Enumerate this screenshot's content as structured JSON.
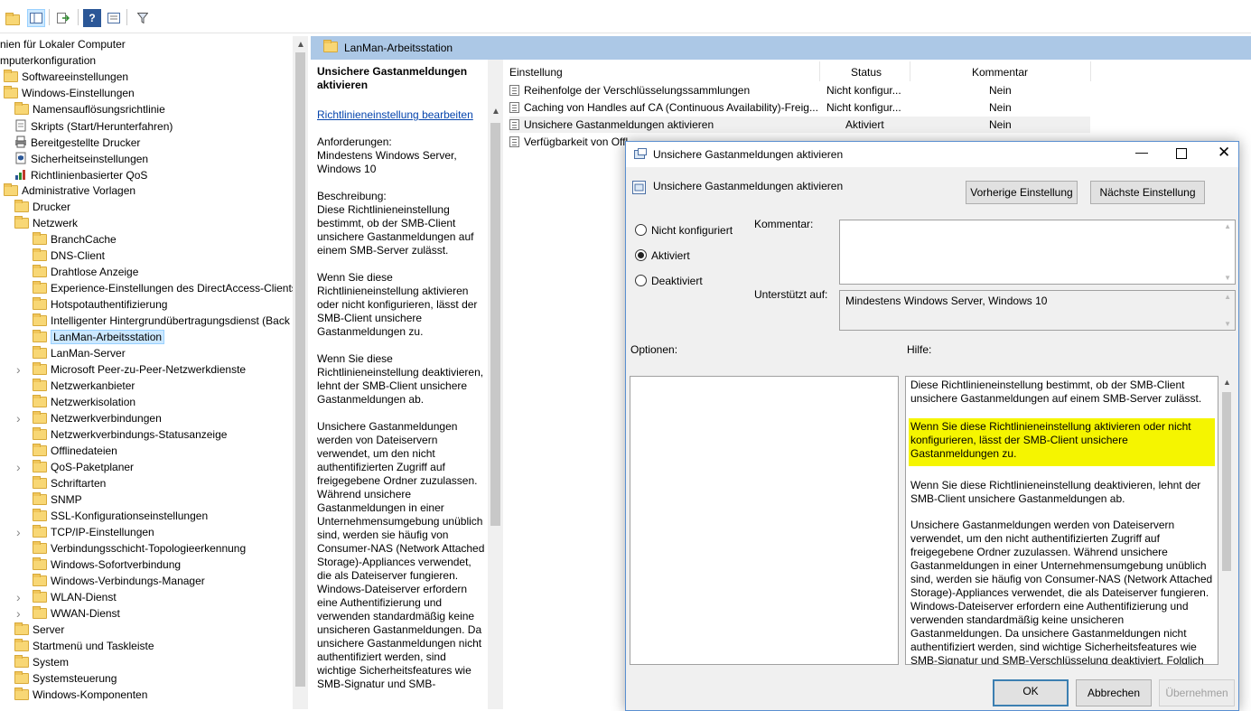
{
  "toolbar": {
    "icons": [
      "folder-icon",
      "show-hide-tree-icon",
      "export-icon",
      "help-icon",
      "properties-icon",
      "filter-icon"
    ]
  },
  "tree": {
    "items": [
      {
        "label": "nien für Lokaler Computer",
        "level": 0
      },
      {
        "label": "mputerkonfiguration",
        "level": 0
      },
      {
        "label": "Softwareeinstellungen",
        "level": 1
      },
      {
        "label": "Windows-Einstellungen",
        "level": 1
      },
      {
        "label": "Namensauflösungsrichtlinie",
        "level": 2
      },
      {
        "label": "Skripts (Start/Herunterfahren)",
        "level": 2
      },
      {
        "label": "Bereitgestellte Drucker",
        "level": 2
      },
      {
        "label": "Sicherheitseinstellungen",
        "level": 2
      },
      {
        "label": "Richtlinienbasierter QoS",
        "level": 2
      },
      {
        "label": "Administrative Vorlagen",
        "level": 1
      },
      {
        "label": "Drucker",
        "level": 2
      },
      {
        "label": "Netzwerk",
        "level": 2
      },
      {
        "label": "BranchCache",
        "level": 3
      },
      {
        "label": "DNS-Client",
        "level": 3
      },
      {
        "label": "Drahtlose Anzeige",
        "level": 3
      },
      {
        "label": "Experience-Einstellungen des DirectAccess-Clients",
        "level": 3
      },
      {
        "label": "Hotspotauthentifizierung",
        "level": 3
      },
      {
        "label": "Intelligenter Hintergrundübertragungsdienst (Back",
        "level": 3
      },
      {
        "label": "LanMan-Arbeitsstation",
        "level": 3
      },
      {
        "label": "LanMan-Server",
        "level": 3
      },
      {
        "label": "Microsoft Peer-zu-Peer-Netzwerkdienste",
        "level": 3
      },
      {
        "label": "Netzwerkanbieter",
        "level": 3
      },
      {
        "label": "Netzwerkisolation",
        "level": 3
      },
      {
        "label": "Netzwerkverbindungen",
        "level": 3
      },
      {
        "label": "Netzwerkverbindungs-Statusanzeige",
        "level": 3
      },
      {
        "label": "Offlinedateien",
        "level": 3
      },
      {
        "label": "QoS-Paketplaner",
        "level": 3
      },
      {
        "label": "Schriftarten",
        "level": 3
      },
      {
        "label": "SNMP",
        "level": 3
      },
      {
        "label": "SSL-Konfigurationseinstellungen",
        "level": 3
      },
      {
        "label": "TCP/IP-Einstellungen",
        "level": 3
      },
      {
        "label": "Verbindungsschicht-Topologieerkennung",
        "level": 3
      },
      {
        "label": "Windows-Sofortverbindung",
        "level": 3
      },
      {
        "label": "Windows-Verbindungs-Manager",
        "level": 3
      },
      {
        "label": "WLAN-Dienst",
        "level": 3
      },
      {
        "label": "WWAN-Dienst",
        "level": 3
      },
      {
        "label": "Server",
        "level": 2
      },
      {
        "label": "Startmenü und Taskleiste",
        "level": 2
      },
      {
        "label": "System",
        "level": 2
      },
      {
        "label": "Systemsteuerung",
        "level": 2
      },
      {
        "label": "Windows-Komponenten",
        "level": 2
      }
    ],
    "selected": "LanMan-Arbeitsstation"
  },
  "node_header": {
    "title": "LanMan-Arbeitsstation"
  },
  "description": {
    "title": "Unsichere Gastanmeldungen aktivieren",
    "edit_link": "Richtlinieneinstellung bearbeiten",
    "requirements_label": "Anforderungen:",
    "requirements": "Mindestens Windows Server, Windows 10",
    "description_label": "Beschreibung:",
    "p1": "Diese Richtlinieneinstellung bestimmt, ob der SMB-Client unsichere Gastanmeldungen auf einem SMB-Server zulässt.",
    "p2": "Wenn Sie diese Richtlinieneinstellung aktivieren oder nicht konfigurieren, lässt der SMB-Client unsichere Gastanmeldungen zu.",
    "p3": "Wenn Sie diese Richtlinieneinstellung deaktivieren, lehnt der SMB-Client unsichere Gastanmeldungen ab.",
    "p4": "Unsichere Gastanmeldungen werden von Dateiservern verwendet, um den nicht authentifizierten Zugriff auf freigegebene Ordner zuzulassen. Während unsichere Gastanmeldungen in einer Unternehmensumgebung unüblich sind, werden sie häufig von Consumer-NAS (Network Attached Storage)-Appliances verwendet, die als Dateiserver fungieren. Windows-Dateiserver erfordern eine Authentifizierung und verwenden standardmäßig keine unsicheren Gastanmeldungen. Da unsichere Gastanmeldungen nicht authentifiziert werden, sind wichtige Sicherheitsfeatures wie SMB-Signatur und SMB-"
  },
  "list": {
    "columns": {
      "setting": "Einstellung",
      "status": "Status",
      "comment": "Kommentar"
    },
    "rows": [
      {
        "setting": "Reihenfolge der Verschlüsselungssammlungen",
        "status": "Nicht konfigur...",
        "comment": "Nein"
      },
      {
        "setting": "Caching von Handles auf CA (Continuous Availability)-Freig...",
        "status": "Nicht konfigur...",
        "comment": "Nein"
      },
      {
        "setting": "Unsichere Gastanmeldungen aktivieren",
        "status": "Aktiviert",
        "comment": "Nein"
      },
      {
        "setting": "Verfügbarkeit von Offl",
        "status": "",
        "comment": ""
      }
    ]
  },
  "dialog": {
    "title": "Unsichere Gastanmeldungen aktivieren",
    "heading": "Unsichere Gastanmeldungen aktivieren",
    "prev_button": "Vorherige Einstellung",
    "next_button": "Nächste Einstellung",
    "radio_not_configured": "Nicht konfiguriert",
    "radio_enabled": "Aktiviert",
    "radio_disabled": "Deaktiviert",
    "selected_option": "Aktiviert",
    "comment_label": "Kommentar:",
    "supported_label": "Unterstützt auf:",
    "supported_value": "Mindestens Windows Server, Windows 10",
    "options_label": "Optionen:",
    "help_label": "Hilfe:",
    "help_p1": "Diese Richtlinieneinstellung bestimmt, ob der SMB-Client unsichere Gastanmeldungen auf einem SMB-Server zulässt.",
    "help_p2": "Wenn Sie diese Richtlinieneinstellung aktivieren oder nicht konfigurieren, lässt der SMB-Client unsichere Gastanmeldungen zu.",
    "help_p3": "Wenn Sie diese Richtlinieneinstellung deaktivieren, lehnt der SMB-Client unsichere Gastanmeldungen ab.",
    "help_p4": "Unsichere Gastanmeldungen werden von Dateiservern verwendet, um den nicht authentifizierten Zugriff auf freigegebene Ordner zuzulassen. Während unsichere Gastanmeldungen in einer Unternehmensumgebung unüblich sind, werden sie häufig von Consumer-NAS (Network Attached Storage)-Appliances verwendet, die als Dateiserver fungieren. Windows-Dateiserver erfordern eine Authentifizierung und verwenden standardmäßig keine unsicheren Gastanmeldungen. Da unsichere Gastanmeldungen nicht authentifiziert werden, sind wichtige Sicherheitsfeatures wie SMB-Signatur und SMB-Verschlüsselung deaktiviert. Folglich haben Clients, die unsichere",
    "ok_button": "OK",
    "cancel_button": "Abbrechen",
    "apply_button": "Übernehmen",
    "highlight_color": "#f5f500"
  }
}
